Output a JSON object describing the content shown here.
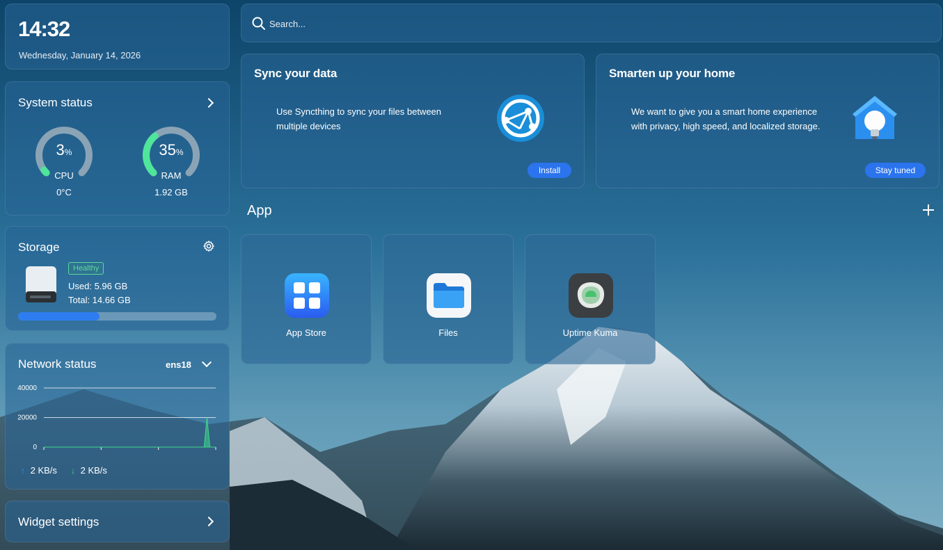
{
  "clock": {
    "time": "14:32",
    "date": "Wednesday, January 14, 2026"
  },
  "system_status": {
    "title": "System status",
    "cpu": {
      "value": "3",
      "unit": "%",
      "label": "CPU",
      "sub": "0°C",
      "percent": 3
    },
    "ram": {
      "value": "35",
      "unit": "%",
      "label": "RAM",
      "sub": "1.92 GB",
      "percent": 35
    },
    "colors": {
      "arc_active": "#4fe59a",
      "arc_track": "#8aa4b6"
    }
  },
  "storage": {
    "title": "Storage",
    "badge": "Healthy",
    "used": "Used: 5.96 GB",
    "total": "Total: 14.66 GB",
    "used_fraction": 0.41,
    "icons": {
      "settings": "gear-icon",
      "disk": "hard-drive-icon"
    }
  },
  "network": {
    "title": "Network status",
    "interface": "ens18",
    "upload": "2 KB/s",
    "download": "2 KB/s",
    "chart_data": {
      "type": "area",
      "y_ticks": [
        "40000",
        "20000",
        "0"
      ],
      "ylim": [
        0,
        40000
      ],
      "series": [
        {
          "values": [
            0,
            0,
            0,
            0,
            0,
            0,
            0,
            0,
            0,
            0,
            0,
            0,
            0,
            0,
            0,
            0,
            0,
            0,
            0,
            0,
            0,
            0,
            0,
            0,
            0,
            0,
            0,
            0,
            0,
            0,
            0,
            0,
            0,
            0,
            0,
            0,
            0,
            0,
            0,
            0,
            0,
            0,
            0,
            0,
            0,
            0,
            0,
            0,
            0,
            0,
            0,
            0,
            0,
            0,
            0,
            0,
            20000,
            0,
            0,
            0
          ]
        }
      ],
      "colors": {
        "upload": "#2e9bf0",
        "download": "#3fd98a"
      }
    }
  },
  "widget_settings": {
    "title": "Widget settings"
  },
  "search": {
    "placeholder": "Search..."
  },
  "promos": [
    {
      "title": "Sync your data",
      "desc": "Use Syncthing to sync your files between multiple devices",
      "button": "Install",
      "icon": "syncthing-icon"
    },
    {
      "title": "Smarten up your home",
      "desc": "We want to give you a smart home experience with privacy, high speed, and localized storage.",
      "button": "Stay tuned",
      "icon": "smart-home-icon"
    }
  ],
  "apps_section": {
    "title": "App",
    "apps": [
      {
        "name": "App Store",
        "icon": "app-store-icon"
      },
      {
        "name": "Files",
        "icon": "folder-icon"
      },
      {
        "name": "Uptime Kuma",
        "icon": "uptime-kuma-icon"
      }
    ]
  },
  "colors": {
    "accent": "#2b74ee"
  }
}
